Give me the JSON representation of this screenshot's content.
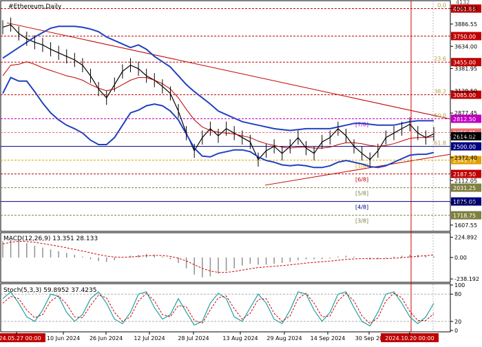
{
  "chart_data": [
    {
      "type": "line",
      "panel": "price",
      "title": "#Ethereum,Daily",
      "x_tick_labels": [
        "2024.05.27 00:00",
        "10 Jun 2024",
        "26 Jun 2024",
        "12 Jul 2024",
        "28 Jul 2024",
        "13 Aug 2024",
        "29 Aug 2024",
        "14 Sep 2024",
        "30 Sep 20",
        "2024.10.20 00:00"
      ],
      "ylim": [
        1560,
        4120
      ],
      "y_ticks": [
        4061.88,
        3886.55,
        3634.0,
        3381.95,
        3129.5,
        2877.45,
        2624.9,
        2372.4,
        2112.05,
        1860.0,
        1607.55
      ],
      "series": [
        {
          "values": [
            3850,
            3880,
            3780,
            3720,
            3680,
            3650,
            3600,
            3560,
            3520,
            3480,
            3420,
            3300,
            3150,
            3050,
            3200,
            3350,
            3420,
            3380,
            3300,
            3250,
            3180,
            3100,
            2900,
            2650,
            2450,
            2600,
            2700,
            2620,
            2700,
            2650,
            2600,
            2550,
            2350,
            2450,
            2500,
            2420,
            2500,
            2600,
            2480,
            2420,
            2550,
            2600,
            2700,
            2620,
            2500,
            2420,
            2350,
            2450,
            2600,
            2650,
            2700,
            2750,
            2650,
            2600,
            2640
          ]
        },
        {
          "values": [
            3300,
            3420,
            3430,
            3460,
            3430,
            3390,
            3360,
            3330,
            3300,
            3280,
            3250,
            3200,
            3160,
            3130,
            3150,
            3200,
            3250,
            3280,
            3280,
            3250,
            3210,
            3150,
            3050,
            2920,
            2800,
            2720,
            2680,
            2660,
            2650,
            2640,
            2620,
            2600,
            2560,
            2530,
            2510,
            2490,
            2480,
            2490,
            2490,
            2480,
            2480,
            2490,
            2520,
            2540,
            2540,
            2530,
            2510,
            2500,
            2510,
            2530,
            2560,
            2590,
            2600,
            2600,
            2610
          ]
        },
        {
          "values": [
            3500,
            3560,
            3620,
            3680,
            3740,
            3790,
            3840,
            3860,
            3860,
            3860,
            3850,
            3830,
            3800,
            3740,
            3700,
            3660,
            3620,
            3650,
            3600,
            3520,
            3460,
            3400,
            3300,
            3200,
            3120,
            3050,
            2980,
            2900,
            2860,
            2820,
            2780,
            2760,
            2740,
            2720,
            2700,
            2690,
            2680,
            2690,
            2700,
            2700,
            2700,
            2700,
            2720,
            2740,
            2760,
            2760,
            2750,
            2740,
            2740,
            2740,
            2760,
            2780,
            2790,
            2790,
            2790
          ]
        },
        {
          "values": [
            3100,
            3280,
            3240,
            3240,
            3120,
            2990,
            2880,
            2800,
            2740,
            2700,
            2650,
            2570,
            2520,
            2520,
            2600,
            2740,
            2880,
            2910,
            2960,
            2980,
            2960,
            2900,
            2800,
            2640,
            2480,
            2390,
            2380,
            2420,
            2440,
            2460,
            2460,
            2440,
            2380,
            2340,
            2320,
            2290,
            2280,
            2290,
            2280,
            2260,
            2260,
            2280,
            2320,
            2340,
            2320,
            2300,
            2270,
            2260,
            2280,
            2320,
            2360,
            2400,
            2410,
            2410,
            2430
          ]
        }
      ],
      "levels": [
        {
          "price_label": "4061.88",
          "price": 4061.88,
          "fib": "0.0"
        },
        {
          "price_label": "3750.00",
          "price": 3750.0,
          "murrey": ""
        },
        {
          "price_label": "3455.00",
          "price": 3455.0,
          "fib": "23.6"
        },
        {
          "price_label": "3085.00",
          "price": 3085.0,
          "fib": "38.2"
        },
        {
          "price_label": "2812.50",
          "price": 2812.5,
          "fib": "50.0",
          "murrey": "[7/8]"
        },
        {
          "price_label": "2656.25",
          "price": 2656.25,
          "fib": ""
        },
        {
          "price_label": "2500.00",
          "price": 2500.0,
          "fib": "61.8"
        },
        {
          "price_label": "2343.75",
          "price": 2343.75,
          "fib": "",
          "murrey": "[1/8]"
        },
        {
          "price_label": "2187.50",
          "price": 2187.5,
          "murrey": "[6/8]"
        },
        {
          "price_label": "2031.25",
          "price": 2031.25,
          "murrey": "[5/8]"
        },
        {
          "price_label": "1875.00",
          "price": 1875.0,
          "murrey": "[4/8]"
        },
        {
          "price_label": "1718.75",
          "price": 1718.75,
          "murrey": "[3/8]"
        }
      ],
      "current_price_label": "2614.02",
      "partial_top_labels": [
        "4132"
      ],
      "grid": false
    },
    {
      "type": "line",
      "panel": "macd",
      "title": "MACD(12,26,9) 13.351 28.133",
      "ylim": [
        -260,
        260
      ],
      "y_ticks": [
        224.892,
        0.0,
        -238.192
      ],
      "histogram": [
        180,
        200,
        190,
        160,
        130,
        110,
        90,
        70,
        50,
        30,
        10,
        -20,
        -40,
        -50,
        -30,
        0,
        20,
        30,
        40,
        30,
        10,
        -20,
        -60,
        -120,
        -190,
        -220,
        -210,
        -180,
        -150,
        -120,
        -90,
        -70,
        -80,
        -80,
        -70,
        -60,
        -50,
        -30,
        -20,
        -20,
        -20,
        -10,
        10,
        20,
        10,
        0,
        -20,
        -20,
        -10,
        10,
        20,
        30,
        30,
        20,
        13
      ],
      "signal": [
        150,
        170,
        180,
        178,
        168,
        155,
        140,
        125,
        108,
        90,
        72,
        52,
        32,
        15,
        5,
        3,
        6,
        12,
        20,
        24,
        22,
        12,
        -8,
        -38,
        -80,
        -120,
        -150,
        -165,
        -165,
        -155,
        -140,
        -124,
        -112,
        -104,
        -97,
        -90,
        -82,
        -72,
        -62,
        -54,
        -47,
        -40,
        -31,
        -21,
        -15,
        -12,
        -13,
        -14,
        -13,
        -8,
        -2,
        6,
        14,
        20,
        28
      ]
    },
    {
      "type": "line",
      "panel": "stochastic",
      "title": "Stoch(5,3,3) 59.8952 37.4235",
      "ylim": [
        0,
        100
      ],
      "y_ticks": [
        100,
        80,
        20,
        0
      ],
      "series": [
        {
          "values": [
            70,
            85,
            60,
            30,
            20,
            45,
            80,
            75,
            40,
            20,
            35,
            70,
            85,
            60,
            25,
            15,
            40,
            80,
            85,
            50,
            25,
            35,
            70,
            40,
            12,
            20,
            60,
            82,
            70,
            30,
            20,
            50,
            80,
            60,
            25,
            15,
            45,
            85,
            80,
            45,
            20,
            40,
            80,
            85,
            50,
            20,
            10,
            40,
            80,
            85,
            60,
            30,
            15,
            30,
            60
          ]
        },
        {
          "values": [
            60,
            75,
            70,
            45,
            28,
            35,
            65,
            76,
            58,
            30,
            28,
            55,
            78,
            72,
            40,
            20,
            30,
            65,
            82,
            65,
            35,
            30,
            55,
            52,
            22,
            16,
            45,
            72,
            76,
            48,
            25,
            38,
            68,
            70,
            38,
            20,
            32,
            70,
            82,
            60,
            30,
            32,
            65,
            82,
            65,
            32,
            15,
            28,
            65,
            82,
            72,
            42,
            22,
            22,
            37
          ]
        }
      ]
    }
  ]
}
